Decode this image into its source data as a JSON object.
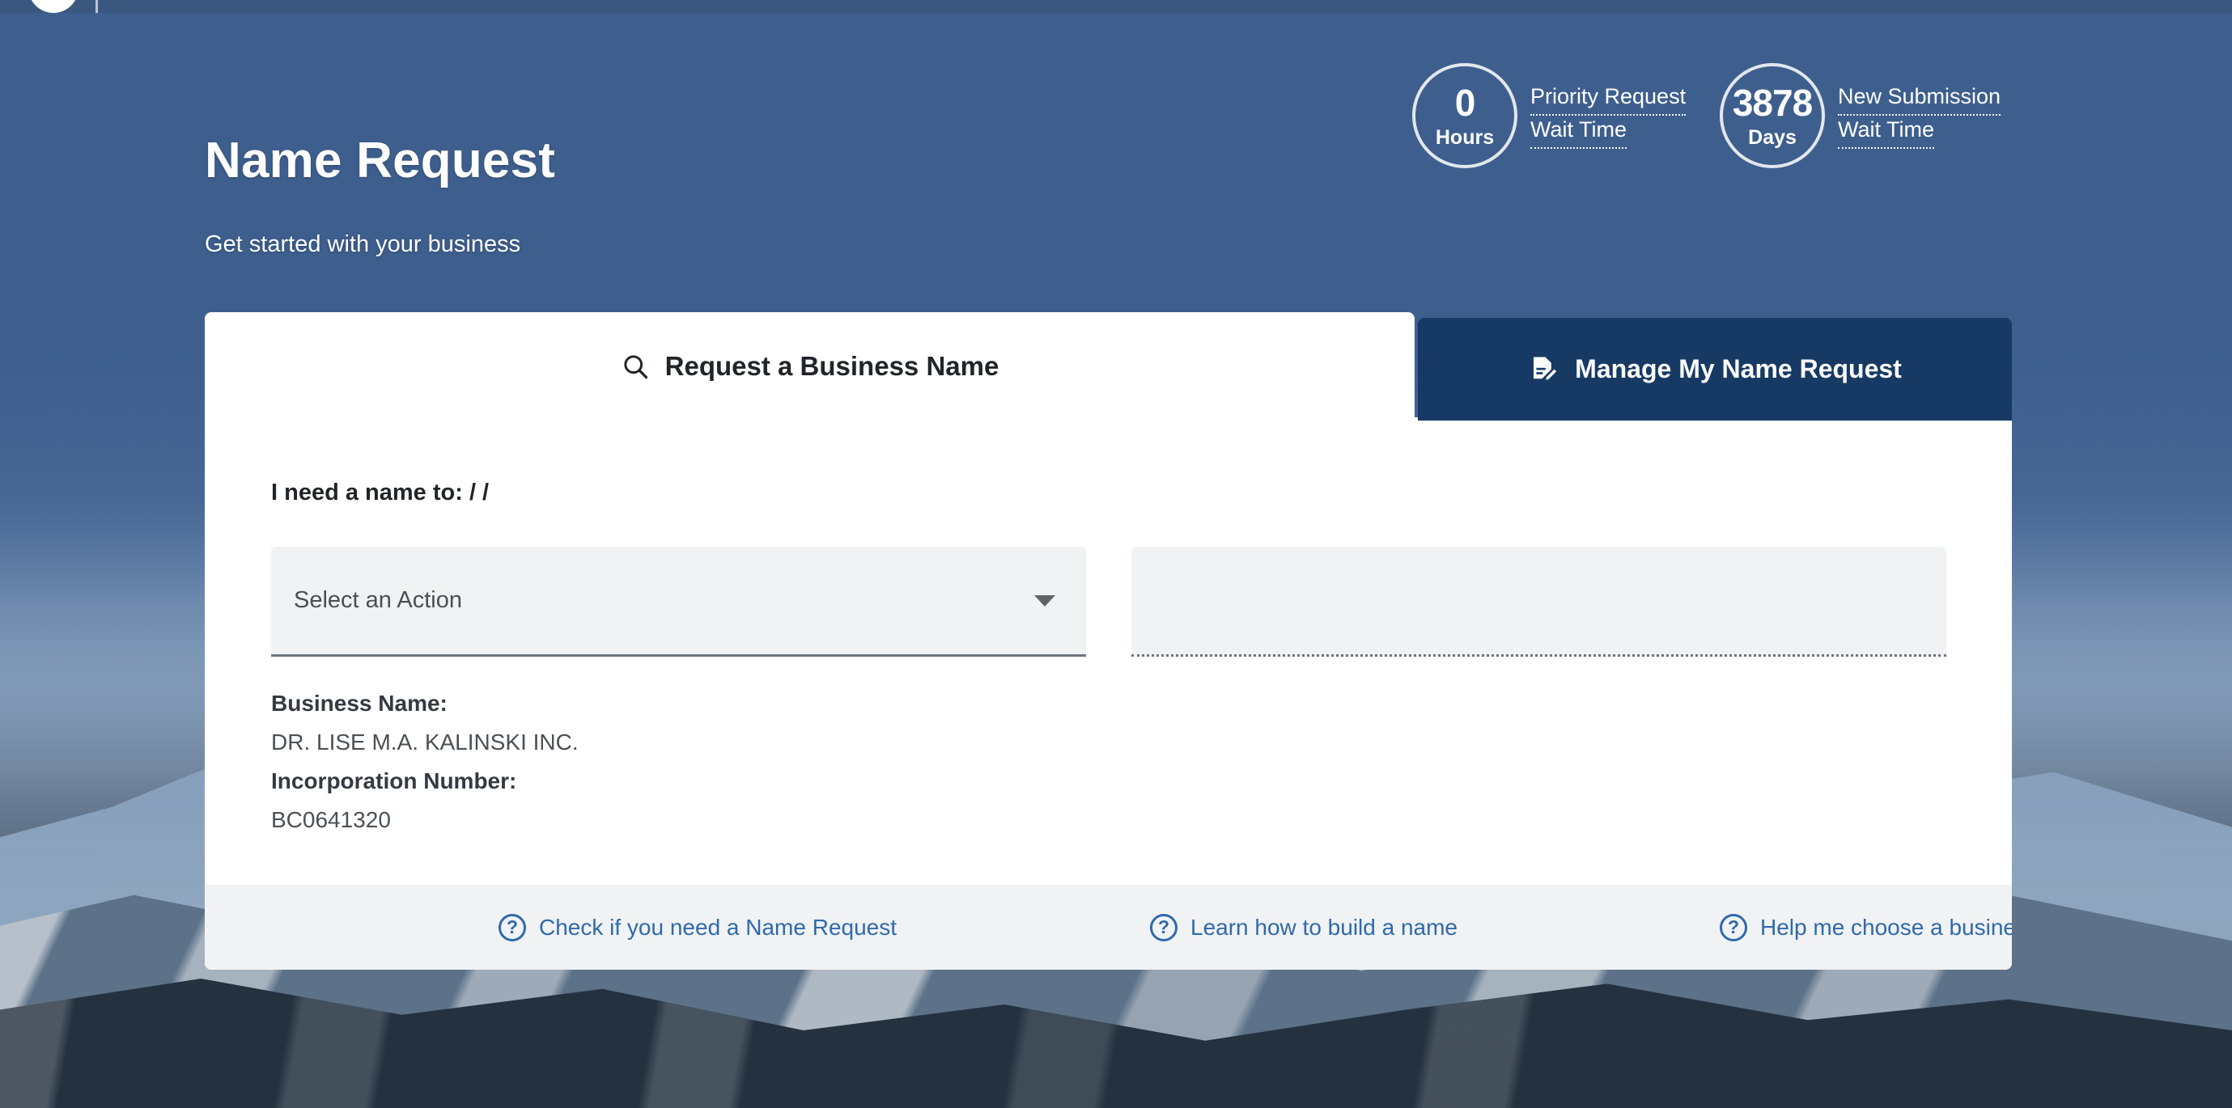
{
  "topbar": {
    "logo_icon": "bc-gov-logo-circle",
    "divider": "vertical-divider"
  },
  "hero": {
    "title": "Name Request",
    "subtitle": "Get started with your business"
  },
  "wait_times": [
    {
      "id": "priority",
      "value": "0",
      "unit": "Hours",
      "label_line1": "Priority Request",
      "label_line2": "Wait Time"
    },
    {
      "id": "new-submission",
      "value": "3878",
      "unit": "Days",
      "label_line1": "New Submission",
      "label_line2": "Wait Time"
    }
  ],
  "tabs": [
    {
      "id": "request-a-business-name",
      "label": "Request a Business Name",
      "icon": "search-icon",
      "active": true
    },
    {
      "id": "manage-my-name-request",
      "label": "Manage My Name Request",
      "icon": "document-edit-icon",
      "active": false
    }
  ],
  "form": {
    "need_label": "I need a name to: / /",
    "action_select": {
      "value": "Select an Action",
      "placeholder": "Select an Action",
      "arrow_icon": "chevron-down-icon"
    },
    "secondary_field": {
      "value": "",
      "placeholder": "",
      "disabled": true
    },
    "details": [
      {
        "label": "Business Name:",
        "value": "DR. LISE M.A. KALINSKI INC."
      },
      {
        "label": "Incorporation Number:",
        "value": "BC0641320"
      }
    ]
  },
  "footer_links": [
    {
      "id": "check-if-you-need",
      "label": "Check if you need a Name Request",
      "icon": "help-circle-icon",
      "external": false
    },
    {
      "id": "learn-how-to-build",
      "label": "Learn how to build a name",
      "icon": "help-circle-icon",
      "external": false
    },
    {
      "id": "help-choose-business-type",
      "label": "Help me choose a business type",
      "icon": "help-circle-icon",
      "external": true
    }
  ],
  "colors": {
    "hero_blue": "#3e5f8e",
    "tab_active_bg": "#ffffff",
    "tab_inactive_bg": "#173a64",
    "link_blue": "#2f6aab",
    "field_bg": "#f1f2f4",
    "card_bg": "#ffffff"
  }
}
